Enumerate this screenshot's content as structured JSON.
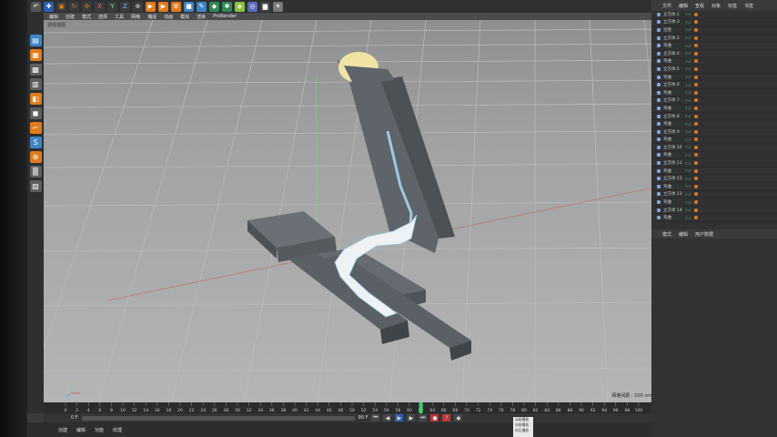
{
  "menu": {
    "items": [
      "编辑",
      "创建",
      "模式",
      "选择",
      "工具",
      "网格",
      "捕捉",
      "动画",
      "模拟",
      "渲染",
      "ProRender"
    ]
  },
  "viewport": {
    "label": "透视视图",
    "status": "网格间距 : 100 cm"
  },
  "timeline": {
    "ticks": [
      "0",
      "2",
      "4",
      "6",
      "8",
      "10",
      "12",
      "14",
      "16",
      "18",
      "20",
      "22",
      "24",
      "26",
      "28",
      "30",
      "32",
      "34",
      "36",
      "38",
      "40",
      "42",
      "44",
      "46",
      "48",
      "50",
      "52",
      "54",
      "56",
      "58",
      "60",
      "62",
      "64",
      "66",
      "68",
      "70",
      "72",
      "74",
      "76",
      "78",
      "80",
      "82",
      "84",
      "86",
      "88",
      "90",
      "92",
      "94",
      "96",
      "98",
      "100"
    ],
    "current_frame": "62 F",
    "start": "0 F",
    "end": "90 F"
  },
  "object_manager": {
    "tabs": [
      "文件",
      "编辑",
      "查看",
      "对象",
      "标签",
      "书签"
    ],
    "objects": [
      "立方体.1",
      "立方体.3",
      "连接",
      "立方体.2",
      "弯曲",
      "立方体.4",
      "弯曲",
      "立方体.5",
      "弯曲",
      "立方体.6",
      "弯曲",
      "立方体.7",
      "弯曲",
      "立方体.8",
      "弯曲",
      "立方体.9",
      "弯曲",
      "立方体.10",
      "弯曲",
      "立方体.11",
      "弯曲",
      "立方体.12",
      "弯曲",
      "立方体.13",
      "弯曲",
      "立方体.14",
      "弯曲"
    ]
  },
  "attribute_manager": {
    "tabs": [
      "模式",
      "编辑",
      "用户数据"
    ]
  },
  "bottom_tabs": [
    "创建",
    "编辑",
    "功能",
    "纹理"
  ],
  "popup": {
    "items": [
      "动画播放",
      "向前播放",
      "向后播放"
    ]
  },
  "colors": {
    "viewport_bg": "#a0a1a2",
    "panel_dark": "#313234",
    "accent_orange": "#e07b1b",
    "object_dark": "#5e646a",
    "light_blue": "#9cc9e6",
    "sphere_yellow": "#f1e2a6"
  }
}
